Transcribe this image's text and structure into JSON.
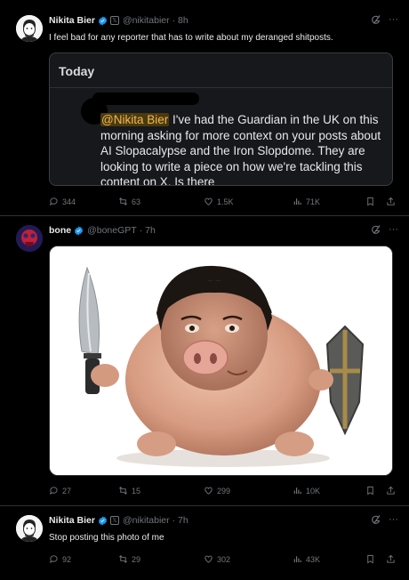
{
  "tweets": [
    {
      "name": "Nikita Bier",
      "handle": "@nikitabier",
      "time": "· 8h",
      "text": "I feel bad for any reporter that has to write about my deranged shitposts.",
      "quote": {
        "header": "Today",
        "mention": "@Nikita Bier",
        "text": " I've had the Guardian in the UK on this morning asking for more context on your posts about AI Slopacalypse and the Iron Slopdome. They are looking to write a piece on how we're tackling this content on X. Is there"
      },
      "stats": {
        "replies": "344",
        "reposts": "63",
        "likes": "1.5K",
        "views": "71K"
      }
    },
    {
      "name": "bone",
      "handle": "@boneGPT",
      "time": "· 7h",
      "stats": {
        "replies": "27",
        "reposts": "15",
        "likes": "299",
        "views": "10K"
      }
    },
    {
      "name": "Nikita Bier",
      "handle": "@nikitabier",
      "time": "· 7h",
      "text": "Stop posting this photo of me",
      "stats": {
        "replies": "92",
        "reposts": "29",
        "likes": "302",
        "views": "43K"
      }
    }
  ],
  "colors": {
    "background": "#000000",
    "verified": "#1d9bf0",
    "muted": "#71767b",
    "highlight": "#f2b84b"
  },
  "icons": [
    "verified-icon",
    "grok-icon",
    "more-icon",
    "reply-icon",
    "repost-icon",
    "like-icon",
    "views-icon",
    "bookmark-icon",
    "share-icon"
  ]
}
